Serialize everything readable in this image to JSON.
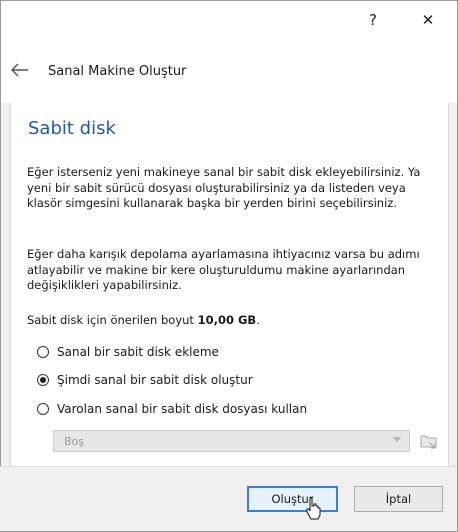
{
  "titlebar": {
    "help": "?",
    "close": "✕"
  },
  "wizard": {
    "title": "Sanal Makine Oluştur"
  },
  "page": {
    "heading": "Sabit disk",
    "paragraph1": "Eğer isterseniz yeni makineye sanal bir sabit disk ekleyebilirsiniz. Ya yeni bir sabit sürücü dosyası oluşturabilirsiniz ya da listeden veya klasör simgesini kullanarak başka bir yerden birini seçebilirsiniz.",
    "paragraph2": "Eğer daha karışık depolama ayarlamasına ihtiyacınız varsa bu adımı atlayabilir ve makine bir kere oluşturuldumu makine ayarlarından değişiklikleri yapabilirsiniz.",
    "recommended_label": "Sabit disk için önerilen boyut ",
    "recommended_value": "10,00 GB",
    "recommended_suffix": "."
  },
  "options": [
    {
      "label": "Sanal bir sabit disk ekleme",
      "checked": false
    },
    {
      "label": "Şimdi sanal bir sabit disk oluştur",
      "checked": true
    },
    {
      "label": "Varolan sanal bir sabit disk dosyası kullan",
      "checked": false
    }
  ],
  "file_select": {
    "value": "Boş",
    "enabled": false
  },
  "buttons": {
    "create": "Oluştur",
    "cancel": "İptal"
  },
  "colors": {
    "heading": "#1f5aa6",
    "default_button_border": "#3c7fd1"
  },
  "icons": [
    "back-arrow-icon",
    "folder-icon",
    "chevron-down-icon",
    "mouse-cursor-icon"
  ]
}
